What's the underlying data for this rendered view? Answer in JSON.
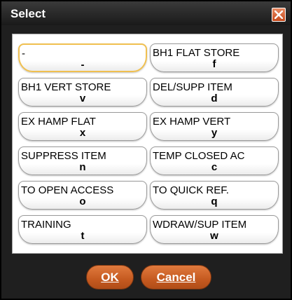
{
  "dialog": {
    "title": "Select",
    "close_icon": "close-x-icon",
    "accent_color": "#c55a20"
  },
  "options": [
    {
      "label": "-",
      "key": "-",
      "selected": true
    },
    {
      "label": "BH1 FLAT STORE",
      "key": "f"
    },
    {
      "label": "BH1 VERT STORE",
      "key": "v"
    },
    {
      "label": "DEL/SUPP ITEM",
      "key": "d"
    },
    {
      "label": "EX HAMP FLAT",
      "key": "x"
    },
    {
      "label": "EX HAMP VERT",
      "key": "y"
    },
    {
      "label": "SUPPRESS ITEM",
      "key": "n"
    },
    {
      "label": "TEMP CLOSED AC",
      "key": "c"
    },
    {
      "label": "TO OPEN ACCESS",
      "key": "o"
    },
    {
      "label": "TO QUICK REF.",
      "key": "q"
    },
    {
      "label": "TRAINING",
      "key": "t"
    },
    {
      "label": "WDRAW/SUP ITEM",
      "key": "w"
    }
  ],
  "buttons": {
    "ok_label": "OK",
    "cancel_label": "Cancel"
  }
}
